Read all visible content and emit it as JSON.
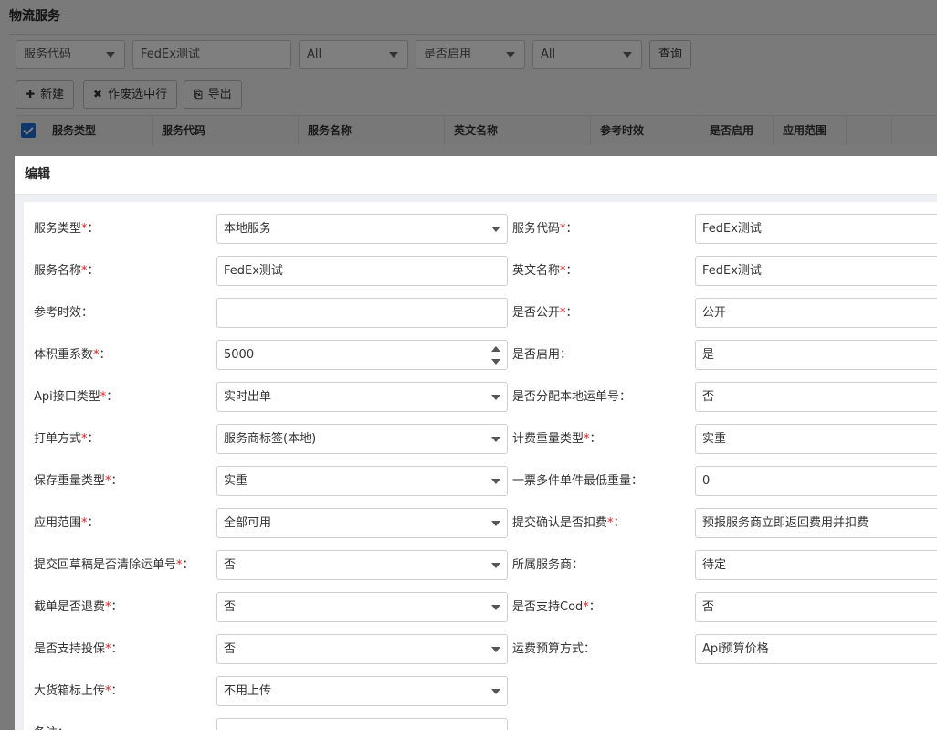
{
  "page": {
    "title": "物流服务"
  },
  "filters": {
    "field_select": "服务代码",
    "keyword_value": "FedEx测试",
    "select_2": "All",
    "enabled_select": "是否启用",
    "select_4": "All",
    "query_button": "查询"
  },
  "toolbar": {
    "new_label": "新建",
    "void_label": "作废选中行",
    "export_label": "导出",
    "new_icon": "plus-icon",
    "void_icon": "close-icon",
    "export_icon": "export-file-icon"
  },
  "table": {
    "headers": [
      "服务类型",
      "服务代码",
      "服务名称",
      "英文名称",
      "参考时效",
      "是否启用",
      "应用范围"
    ]
  },
  "modal": {
    "title": "编辑",
    "rows": [
      {
        "left": {
          "label": "服务类型",
          "required": true,
          "value": "本地服务",
          "type": "select"
        },
        "right": {
          "label": "服务代码",
          "required": true,
          "value": "FedEx测试",
          "type": "input"
        }
      },
      {
        "left": {
          "label": "服务名称",
          "required": true,
          "value": "FedEx测试",
          "type": "input"
        },
        "right": {
          "label": "英文名称",
          "required": true,
          "value": "FedEx测试",
          "type": "input"
        }
      },
      {
        "left": {
          "label": "参考时效",
          "required": false,
          "value": "",
          "type": "input"
        },
        "right": {
          "label": "是否公开",
          "required": true,
          "value": "公开",
          "type": "input"
        }
      },
      {
        "left": {
          "label": "体积重系数",
          "required": true,
          "value": "5000",
          "type": "number"
        },
        "right": {
          "label": "是否启用",
          "required": false,
          "value": "是",
          "type": "input"
        }
      },
      {
        "left": {
          "label": "Api接口类型",
          "required": true,
          "value": "实时出单",
          "type": "select"
        },
        "right": {
          "label": "是否分配本地运单号",
          "required": false,
          "value": "否",
          "type": "input"
        }
      },
      {
        "left": {
          "label": "打单方式",
          "required": true,
          "value": "服务商标签(本地)",
          "type": "select"
        },
        "right": {
          "label": "计费重量类型",
          "required": true,
          "value": "实重",
          "type": "input"
        }
      },
      {
        "left": {
          "label": "保存重量类型",
          "required": true,
          "value": "实重",
          "type": "select"
        },
        "right": {
          "label": "一票多件单件最低重量",
          "required": false,
          "value": "0",
          "type": "input"
        }
      },
      {
        "left": {
          "label": "应用范围",
          "required": true,
          "value": "全部可用",
          "type": "select"
        },
        "right": {
          "label": "提交确认是否扣费",
          "required": true,
          "value": "预报服务商立即返回费用并扣费",
          "type": "input"
        }
      },
      {
        "left": {
          "label": "提交回草稿是否清除运单号",
          "required": true,
          "value": "否",
          "type": "select"
        },
        "right": {
          "label": "所属服务商",
          "required": false,
          "value": "待定",
          "type": "input"
        }
      },
      {
        "left": {
          "label": "截单是否退费",
          "required": true,
          "value": "否",
          "type": "select"
        },
        "right": {
          "label": "是否支持Cod",
          "required": true,
          "value": "否",
          "type": "input"
        }
      },
      {
        "left": {
          "label": "是否支持投保",
          "required": true,
          "value": "否",
          "type": "select"
        },
        "right": {
          "label": "运费预算方式",
          "required": false,
          "value": "Api预算价格",
          "type": "input"
        }
      },
      {
        "left": {
          "label": "大货箱标上传",
          "required": true,
          "value": "不用上传",
          "type": "select"
        },
        "right": null
      },
      {
        "left": {
          "label": "备注",
          "required": false,
          "value": "",
          "type": "input"
        },
        "right": null
      }
    ]
  }
}
